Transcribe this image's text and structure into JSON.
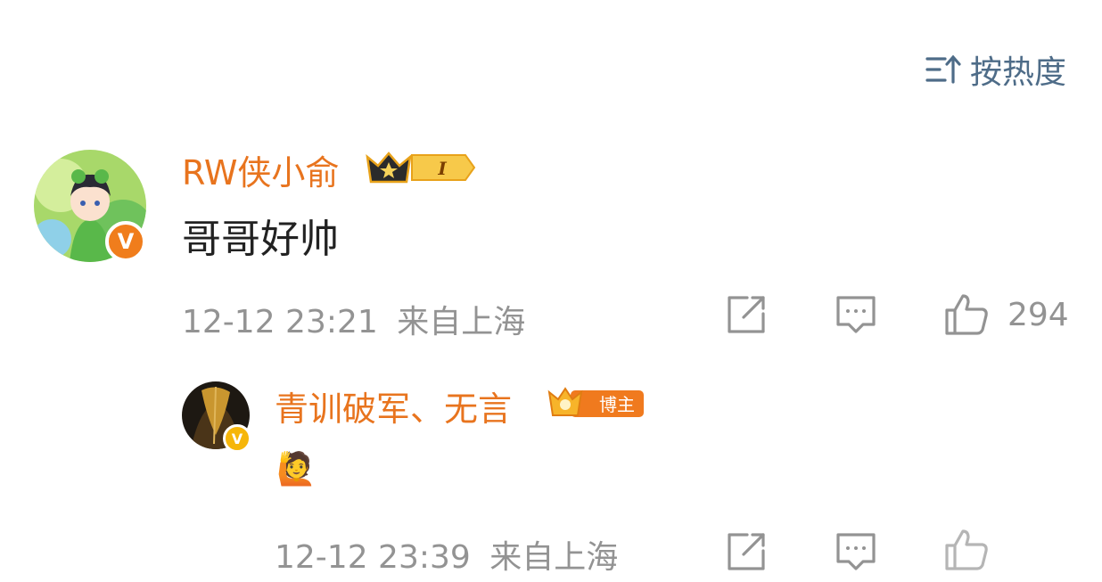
{
  "sort": {
    "icon": "sort-icon",
    "label": "按热度"
  },
  "comments": [
    {
      "author": "RW侠小俞",
      "badge_level": "I",
      "text": "哥哥好帅",
      "time": "12-12 23:21",
      "location": "来自上海",
      "likes": "294",
      "avatar_icon": "frog-hood-avatar",
      "verified_color": "#f07d1c"
    }
  ],
  "reply": {
    "author": "青训破军、无言",
    "badge_label": "博主",
    "emoji": "🙋",
    "time": "12-12 23:39",
    "location": "来自上海",
    "avatar_icon": "dark-avatar",
    "verified_color": "#f6b60a"
  },
  "colors": {
    "accent": "#e8741e",
    "sort": "#4e6c88",
    "meta": "#939393"
  }
}
